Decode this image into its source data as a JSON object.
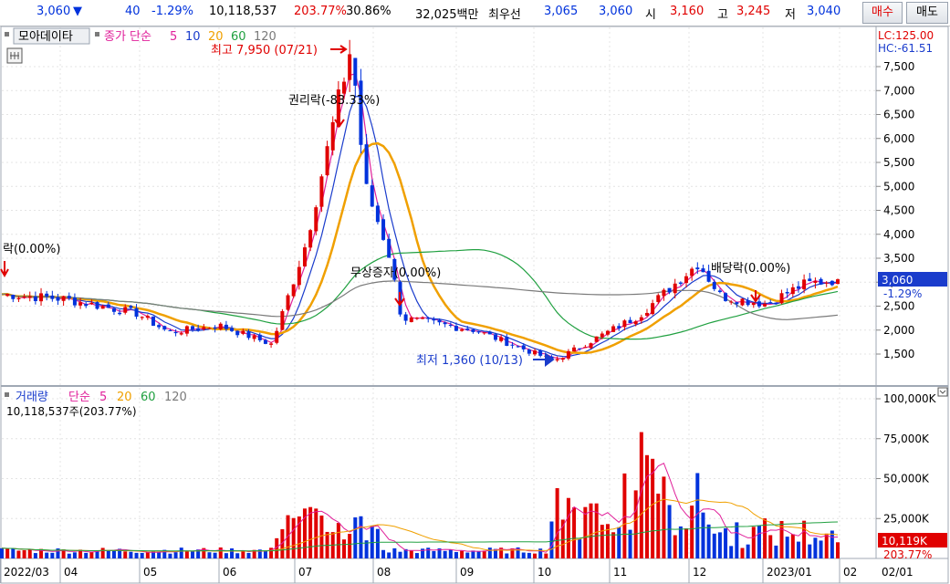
{
  "quote": {
    "price": "3,060",
    "change_arrow": "▼",
    "change": "40",
    "change_pct": "-1.29%",
    "volume": "10,118,537",
    "volume_ratio": "203.77%",
    "turnover": "30.86%",
    "amount": "32,025백만",
    "best_ask_label": "최우선",
    "best_ask": "3,065",
    "best_bid": "3,060",
    "open_label": "시",
    "open": "3,160",
    "high_label": "고",
    "high": "3,245",
    "low_label": "저",
    "low": "3,040",
    "buy_label": "매수",
    "sell_label": "매도",
    "up_color": "#e00000",
    "down_color": "#0032dc"
  },
  "price_panel": {
    "menu_label": "모아데이타",
    "ma_label": "종가 단순",
    "ma_periods": [
      "5",
      "10",
      "20",
      "60",
      "120"
    ],
    "ma_colors": [
      "#e0209a",
      "#1a3ccc",
      "#f0a000",
      "#20a040",
      "#7a7a7a"
    ],
    "lc": "LC:125.00",
    "hc": "HC:-61.51",
    "y_ticks": [
      "7,500",
      "7,000",
      "6,500",
      "6,000",
      "5,500",
      "5,000",
      "4,500",
      "4,000",
      "3,500",
      "3,000",
      "2,500",
      "2,000",
      "1,500"
    ],
    "last_price_box": "3,060",
    "last_change_box": "-1.29%",
    "annotations": {
      "high": "최고 7,950 (07/21)",
      "rights": "권리락(-83.33%)",
      "bonus": "무상증자(0.00%)",
      "low": "최저 1,360 (10/13)",
      "dividend": "배당락(0.00%)",
      "left_ex": "락(0.00%)"
    }
  },
  "volume_panel": {
    "label": "거래량",
    "ma_label": "단순",
    "ma_periods": [
      "5",
      "20",
      "60",
      "120"
    ],
    "current": "10,118,537주(203.77%)",
    "y_ticks": [
      "100,000K",
      "75,000K",
      "50,000K",
      "25,000K"
    ],
    "last_box": "10,119K",
    "last_pct": "203.77%"
  },
  "x_labels": [
    "2022/03",
    "04",
    "05",
    "06",
    "07",
    "08",
    "09",
    "10",
    "11",
    "12",
    "2023/01",
    "02",
    "02/01"
  ],
  "chart_data": {
    "type": "candlestick",
    "period": "daily",
    "x_range": [
      "2022/03",
      "2023/02"
    ],
    "price_ylim": [
      1300,
      7950
    ],
    "price_points": [
      {
        "date": "2022/03",
        "close": 2750
      },
      {
        "date": "2022/04",
        "close": 2650
      },
      {
        "date": "2022/05",
        "close": 2350
      },
      {
        "date": "2022/05",
        "close": 1950
      },
      {
        "date": "2022/06",
        "close": 2100
      },
      {
        "date": "2022/06",
        "close": 1700
      },
      {
        "date": "2022/07",
        "close": 3800
      },
      {
        "date": "2022/07/21",
        "close": 7950
      },
      {
        "date": "2022/07",
        "close": 5000
      },
      {
        "date": "2022/08",
        "close": 3700
      },
      {
        "date": "2022/08",
        "close": 2250
      },
      {
        "date": "2022/09",
        "close": 2000
      },
      {
        "date": "2022/10/13",
        "close": 1360
      },
      {
        "date": "2022/10",
        "close": 1700
      },
      {
        "date": "2022/11",
        "close": 2300
      },
      {
        "date": "2022/12",
        "close": 3400
      },
      {
        "date": "2022/12",
        "close": 2700
      },
      {
        "date": "2023/01",
        "close": 2550
      },
      {
        "date": "2023/01",
        "close": 2950
      },
      {
        "date": "2023/02/01",
        "close": 3060
      }
    ],
    "volume_ylim": [
      0,
      100000
    ],
    "volume_unit": "K"
  }
}
